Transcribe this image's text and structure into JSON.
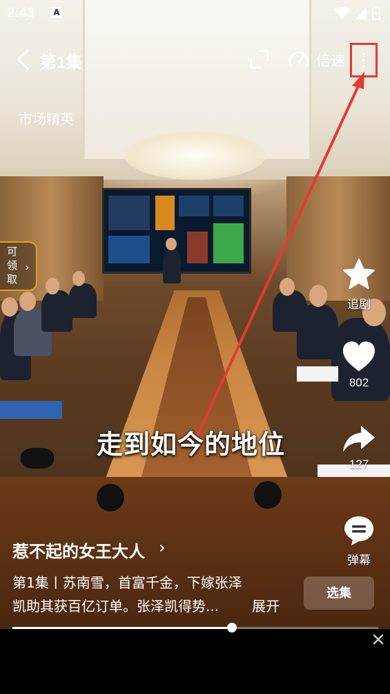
{
  "status": {
    "time": "2:43",
    "a_badge": "A"
  },
  "player": {
    "episode_title": "第1集",
    "speed_label": "倍速",
    "watermark": "市场精英",
    "subtitle": "走到如今的地位",
    "progress_fraction": 0.6
  },
  "claim": {
    "label": "可领取",
    "chars": [
      "可",
      "领",
      "取"
    ],
    "arrow": "›"
  },
  "side_actions": {
    "follow": {
      "label": "追剧",
      "icon": "star-icon"
    },
    "like": {
      "count": "802",
      "icon": "heart-icon"
    },
    "share": {
      "count": "127",
      "icon": "share-icon"
    },
    "danmaku": {
      "label": "弹幕",
      "icon": "danmaku-icon"
    }
  },
  "drama": {
    "title": "惹不起的女王大人",
    "arrow": "›",
    "description_line1": "第1集丨苏南雪，首富千金，下嫁张泽",
    "description_line2": "凯助其获百亿订单。张泽凯得势...",
    "expand_label": "展开",
    "select_episode_label": "选集"
  },
  "colors": {
    "annotation_red": "#e53935",
    "claim_border": "#e8a21f"
  }
}
